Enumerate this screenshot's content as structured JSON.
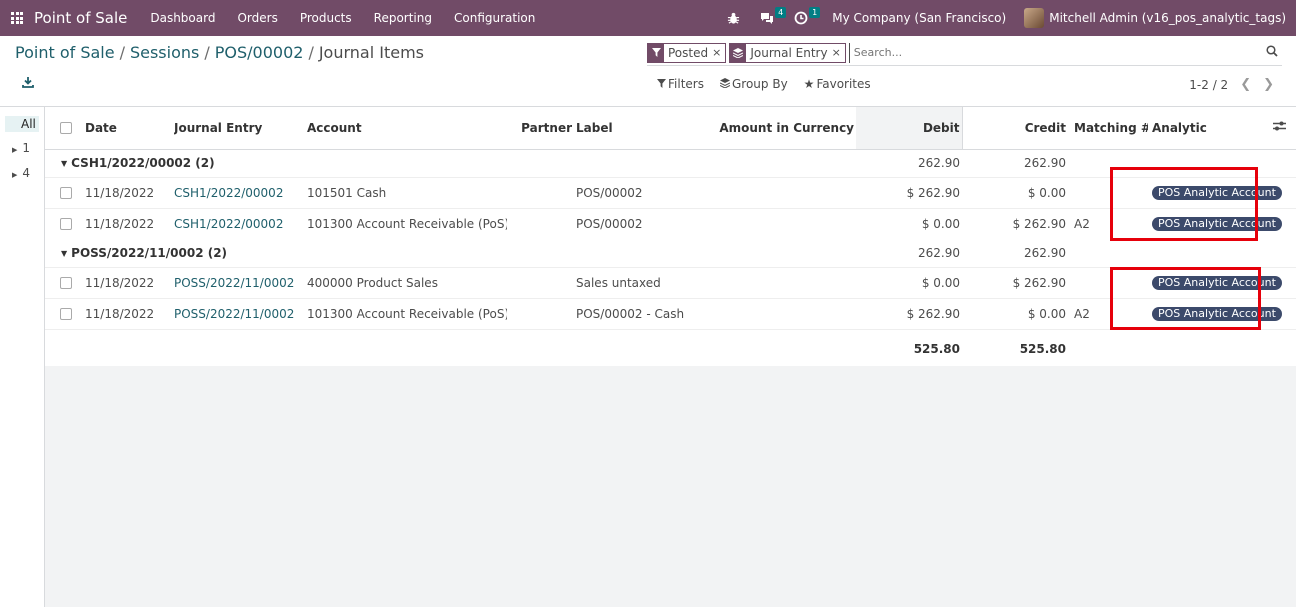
{
  "navbar": {
    "brand": "Point of Sale",
    "menu": [
      "Dashboard",
      "Orders",
      "Products",
      "Reporting",
      "Configuration"
    ],
    "chat_count": "4",
    "activity_count": "1",
    "company": "My Company (San Francisco)",
    "user": "Mitchell Admin (v16_pos_analytic_tags)"
  },
  "breadcrumb": {
    "items": [
      "Point of Sale",
      "Sessions",
      "POS/00002"
    ],
    "current": "Journal Items",
    "sep": "/"
  },
  "search": {
    "facets": [
      "Posted",
      "Journal Entry"
    ],
    "placeholder": "Search...",
    "filters_label": "Filters",
    "groupby_label": "Group By",
    "favorites_label": "Favorites",
    "pager": "1-2 / 2"
  },
  "sidepanel": {
    "items": [
      "All",
      "1",
      "4"
    ]
  },
  "columns": {
    "date": "Date",
    "journal_entry": "Journal Entry",
    "account": "Account",
    "partner": "Partner",
    "label": "Label",
    "amount_currency": "Amount in Currency",
    "debit": "Debit",
    "credit": "Credit",
    "matching": "Matching #",
    "analytic": "Analytic"
  },
  "groups": [
    {
      "name": "CSH1/2022/00002 (2)",
      "debit": "262.90",
      "credit": "262.90",
      "rows": [
        {
          "date": "11/18/2022",
          "entry": "CSH1/2022/00002",
          "account": "101501 Cash",
          "partner": "",
          "label": "POS/00002",
          "amount_currency": "",
          "debit": "$ 262.90",
          "credit": "$ 0.00",
          "matching": "",
          "analytic": "POS Analytic Account"
        },
        {
          "date": "11/18/2022",
          "entry": "CSH1/2022/00002",
          "account": "101300 Account Receivable (PoS)",
          "partner": "",
          "label": "POS/00002",
          "amount_currency": "",
          "debit": "$ 0.00",
          "credit": "$ 262.90",
          "matching": "A2",
          "analytic": "POS Analytic Account"
        }
      ]
    },
    {
      "name": "POSS/2022/11/0002 (2)",
      "debit": "262.90",
      "credit": "262.90",
      "rows": [
        {
          "date": "11/18/2022",
          "entry": "POSS/2022/11/0002",
          "account": "400000 Product Sales",
          "partner": "",
          "label": "Sales untaxed",
          "amount_currency": "",
          "debit": "$ 0.00",
          "credit": "$ 262.90",
          "matching": "",
          "analytic": "POS Analytic Account"
        },
        {
          "date": "11/18/2022",
          "entry": "POSS/2022/11/0002",
          "account": "101300 Account Receivable (PoS)",
          "partner": "",
          "label": "POS/00002 - Cash",
          "amount_currency": "",
          "debit": "$ 262.90",
          "credit": "$ 0.00",
          "matching": "A2",
          "analytic": "POS Analytic Account"
        }
      ]
    }
  ],
  "totals": {
    "debit": "525.80",
    "credit": "525.80"
  },
  "colors": {
    "navbar": "#714b67",
    "link": "#1f5f6b",
    "tag": "#3c4a6b",
    "highlight": "#e6000b"
  }
}
